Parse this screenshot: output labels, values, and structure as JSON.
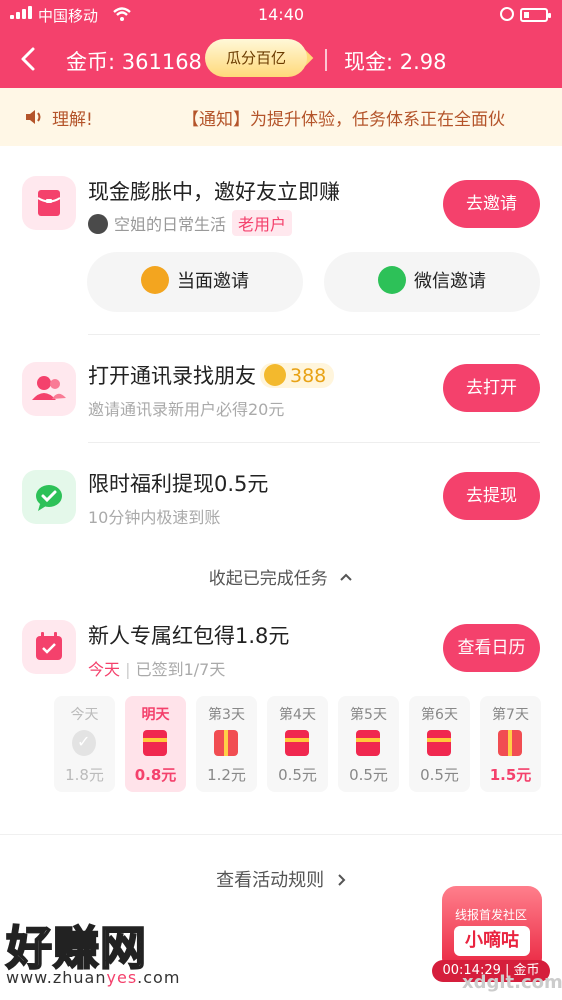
{
  "status_bar": {
    "carrier": "中国移动",
    "time": "14:40"
  },
  "header": {
    "coins_label": "金币: 361168",
    "pill_label": "瓜分百亿",
    "cash_label": "现金: 2.98"
  },
  "notice": {
    "left_text": "理解!",
    "right_text": "【通知】为提升体验，任务体系正在全面伙"
  },
  "invite_task": {
    "title": "现金膨胀中，邀好友立即赚",
    "user_name": "空姐的日常生活",
    "user_tag": "老用户",
    "button": "去邀请",
    "face_invite": "当面邀请",
    "wechat_invite": "微信邀请"
  },
  "contacts_task": {
    "title": "打开通讯录找朋友",
    "coin_reward": "388",
    "subtitle": "邀请通讯录新用户必得20元",
    "button": "去打开"
  },
  "withdraw_task": {
    "title": "限时福利提现0.5元",
    "subtitle": "10分钟内极速到账",
    "button": "去提现"
  },
  "collapse_label": "收起已完成任务",
  "checkin": {
    "title": "新人专属红包得1.8元",
    "today_label": "今天",
    "progress": "已签到1/7天",
    "button": "查看日历",
    "days": [
      {
        "label": "今天",
        "value": "1.8元"
      },
      {
        "label": "明天",
        "value": "0.8元"
      },
      {
        "label": "第3天",
        "value": "1.2元"
      },
      {
        "label": "第4天",
        "value": "0.5元"
      },
      {
        "label": "第5天",
        "value": "0.5元"
      },
      {
        "label": "第6天",
        "value": "0.5元"
      },
      {
        "label": "第7天",
        "value": "1.5元"
      }
    ]
  },
  "rules_label": "查看活动规则",
  "float_badge": {
    "line1": "线报首发社区",
    "line2": "小嘀咕",
    "line3": "00:14:29 | 金币"
  },
  "watermark": {
    "text": "好赚网",
    "site_prefix": "www.zhuan",
    "site_em": "yes",
    "site_suffix": ".com",
    "corner": "xdglt.com"
  },
  "colors": {
    "brand": "#f4416c",
    "notice_bg": "#fff7e6",
    "coin": "#f3b92d",
    "wechat": "#2dc158"
  },
  "icons": [
    "back-icon",
    "speaker-icon",
    "red-envelope-icon",
    "avatar",
    "scan-icon",
    "wechat-icon",
    "contacts-icon",
    "coin-icon",
    "chat-check-icon",
    "chevron-up-icon",
    "calendar-icon",
    "chevron-right-icon"
  ]
}
